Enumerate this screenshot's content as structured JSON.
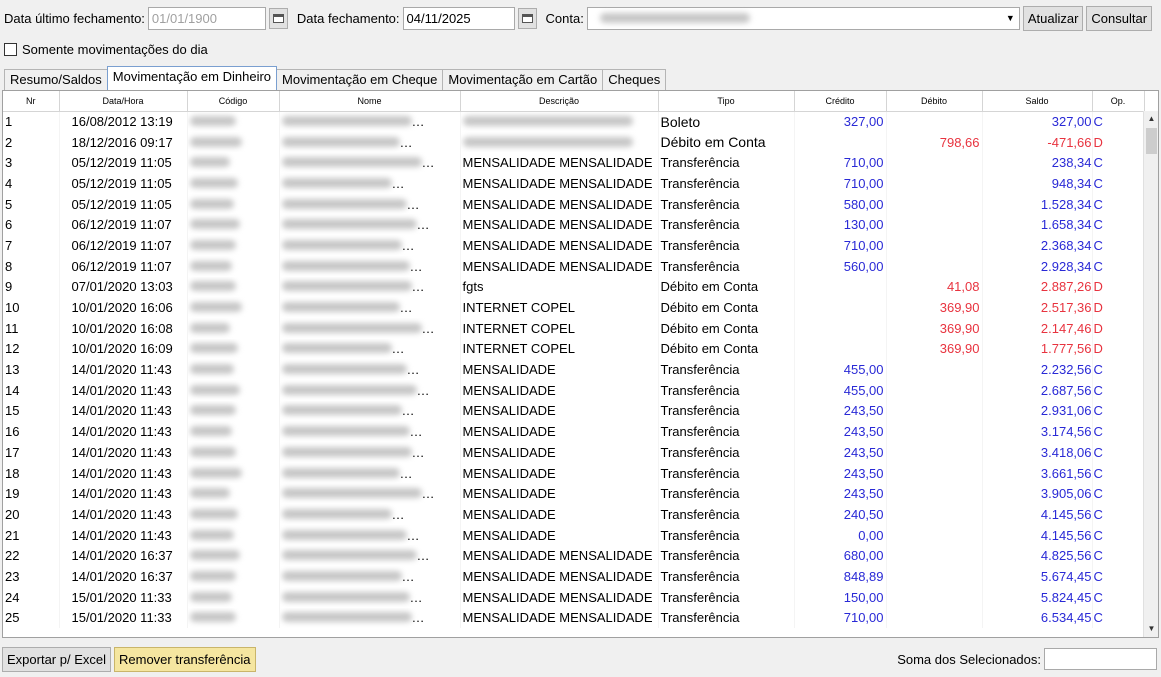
{
  "toolbar": {
    "last_close_label": "Data último fechamento:",
    "last_close_value": "01/01/1900",
    "close_label": "Data fechamento:",
    "close_value": "04/11/2025",
    "account_label": "Conta:",
    "refresh_label": "Atualizar",
    "query_label": "Consultar"
  },
  "filter": {
    "only_today_label": "Somente movimentações do dia"
  },
  "tabs": [
    {
      "label": "Resumo/Saldos"
    },
    {
      "label": "Movimentação em Dinheiro"
    },
    {
      "label": "Movimentação em Cheque"
    },
    {
      "label": "Movimentação em Cartão"
    },
    {
      "label": "Cheques"
    }
  ],
  "active_tab": 1,
  "grid": {
    "columns": [
      "Nr",
      "Data/Hora",
      "Código",
      "Nome",
      "Descrição",
      "Tipo",
      "Crédito",
      "Débito",
      "Saldo",
      "Op."
    ],
    "rows": [
      {
        "nr": "1",
        "datetime": "16/08/2012 13:19",
        "descricao": "Boleto",
        "tipo": "",
        "credito": "327,00",
        "debito": "",
        "saldo": "327,00",
        "op": "C",
        "desc_blur": true
      },
      {
        "nr": "2",
        "datetime": "18/12/2016 09:17",
        "descricao": "Débito em Conta",
        "tipo": "",
        "credito": "",
        "debito": "798,66",
        "saldo": "-471,66",
        "op": "D",
        "desc_blur": true
      },
      {
        "nr": "3",
        "datetime": "05/12/2019 11:05",
        "descricao": "MENSALIDADE MENSALIDADE",
        "tipo": "Transferência",
        "credito": "710,00",
        "debito": "",
        "saldo": "238,34",
        "op": "C"
      },
      {
        "nr": "4",
        "datetime": "05/12/2019 11:05",
        "descricao": "MENSALIDADE MENSALIDADE",
        "tipo": "Transferência",
        "credito": "710,00",
        "debito": "",
        "saldo": "948,34",
        "op": "C"
      },
      {
        "nr": "5",
        "datetime": "05/12/2019 11:05",
        "descricao": "MENSALIDADE MENSALIDADE",
        "tipo": "Transferência",
        "credito": "580,00",
        "debito": "",
        "saldo": "1.528,34",
        "op": "C"
      },
      {
        "nr": "6",
        "datetime": "06/12/2019 11:07",
        "descricao": "MENSALIDADE MENSALIDADE",
        "tipo": "Transferência",
        "credito": "130,00",
        "debito": "",
        "saldo": "1.658,34",
        "op": "C"
      },
      {
        "nr": "7",
        "datetime": "06/12/2019 11:07",
        "descricao": "MENSALIDADE MENSALIDADE",
        "tipo": "Transferência",
        "credito": "710,00",
        "debito": "",
        "saldo": "2.368,34",
        "op": "C"
      },
      {
        "nr": "8",
        "datetime": "06/12/2019 11:07",
        "descricao": "MENSALIDADE MENSALIDADE",
        "tipo": "Transferência",
        "credito": "560,00",
        "debito": "",
        "saldo": "2.928,34",
        "op": "C"
      },
      {
        "nr": "9",
        "datetime": "07/01/2020 13:03",
        "descricao": "fgts",
        "tipo": "Débito em Conta",
        "credito": "",
        "debito": "41,08",
        "saldo": "2.887,26",
        "op": "D"
      },
      {
        "nr": "10",
        "datetime": "10/01/2020 16:06",
        "descricao": "INTERNET COPEL",
        "tipo": "Débito em Conta",
        "credito": "",
        "debito": "369,90",
        "saldo": "2.517,36",
        "op": "D"
      },
      {
        "nr": "11",
        "datetime": "10/01/2020 16:08",
        "descricao": "INTERNET COPEL",
        "tipo": "Débito em Conta",
        "credito": "",
        "debito": "369,90",
        "saldo": "2.147,46",
        "op": "D"
      },
      {
        "nr": "12",
        "datetime": "10/01/2020 16:09",
        "descricao": "INTERNET COPEL",
        "tipo": "Débito em Conta",
        "credito": "",
        "debito": "369,90",
        "saldo": "1.777,56",
        "op": "D"
      },
      {
        "nr": "13",
        "datetime": "14/01/2020 11:43",
        "descricao": "MENSALIDADE",
        "tipo": "Transferência",
        "credito": "455,00",
        "debito": "",
        "saldo": "2.232,56",
        "op": "C"
      },
      {
        "nr": "14",
        "datetime": "14/01/2020 11:43",
        "descricao": "MENSALIDADE",
        "tipo": "Transferência",
        "credito": "455,00",
        "debito": "",
        "saldo": "2.687,56",
        "op": "C"
      },
      {
        "nr": "15",
        "datetime": "14/01/2020 11:43",
        "descricao": "MENSALIDADE",
        "tipo": "Transferência",
        "credito": "243,50",
        "debito": "",
        "saldo": "2.931,06",
        "op": "C"
      },
      {
        "nr": "16",
        "datetime": "14/01/2020 11:43",
        "descricao": "MENSALIDADE",
        "tipo": "Transferência",
        "credito": "243,50",
        "debito": "",
        "saldo": "3.174,56",
        "op": "C"
      },
      {
        "nr": "17",
        "datetime": "14/01/2020 11:43",
        "descricao": "MENSALIDADE",
        "tipo": "Transferência",
        "credito": "243,50",
        "debito": "",
        "saldo": "3.418,06",
        "op": "C"
      },
      {
        "nr": "18",
        "datetime": "14/01/2020 11:43",
        "descricao": "MENSALIDADE",
        "tipo": "Transferência",
        "credito": "243,50",
        "debito": "",
        "saldo": "3.661,56",
        "op": "C"
      },
      {
        "nr": "19",
        "datetime": "14/01/2020 11:43",
        "descricao": "MENSALIDADE",
        "tipo": "Transferência",
        "credito": "243,50",
        "debito": "",
        "saldo": "3.905,06",
        "op": "C"
      },
      {
        "nr": "20",
        "datetime": "14/01/2020 11:43",
        "descricao": "MENSALIDADE",
        "tipo": "Transferência",
        "credito": "240,50",
        "debito": "",
        "saldo": "4.145,56",
        "op": "C"
      },
      {
        "nr": "21",
        "datetime": "14/01/2020 11:43",
        "descricao": "MENSALIDADE",
        "tipo": "Transferência",
        "credito": "0,00",
        "debito": "",
        "saldo": "4.145,56",
        "op": "C"
      },
      {
        "nr": "22",
        "datetime": "14/01/2020 16:37",
        "descricao": "MENSALIDADE MENSALIDADE",
        "tipo": "Transferência",
        "credito": "680,00",
        "debito": "",
        "saldo": "4.825,56",
        "op": "C"
      },
      {
        "nr": "23",
        "datetime": "14/01/2020 16:37",
        "descricao": "MENSALIDADE MENSALIDADE",
        "tipo": "Transferência",
        "credito": "848,89",
        "debito": "",
        "saldo": "5.674,45",
        "op": "C"
      },
      {
        "nr": "24",
        "datetime": "15/01/2020 11:33",
        "descricao": "MENSALIDADE MENSALIDADE",
        "tipo": "Transferência",
        "credito": "150,00",
        "debito": "",
        "saldo": "5.824,45",
        "op": "C"
      },
      {
        "nr": "25",
        "datetime": "15/01/2020 11:33",
        "descricao": "MENSALIDADE MENSALIDADE",
        "tipo": "Transferência",
        "credito": "710,00",
        "debito": "",
        "saldo": "6.534,45",
        "op": "C"
      }
    ]
  },
  "footer": {
    "export_label": "Exportar p/ Excel",
    "remove_label": "Remover transferência",
    "sum_label": "Soma dos Selecionados:"
  },
  "colors": {
    "credit": "#2929d6",
    "debit": "#e8333f",
    "remove_button": "#f5e6a0",
    "active_tab_border": "#7a9fd0"
  },
  "icons": {
    "calendar": "calendar-icon",
    "dropdown": "chevron-down-icon",
    "scroll_up": "arrow-up-icon",
    "scroll_down": "arrow-down-icon"
  }
}
